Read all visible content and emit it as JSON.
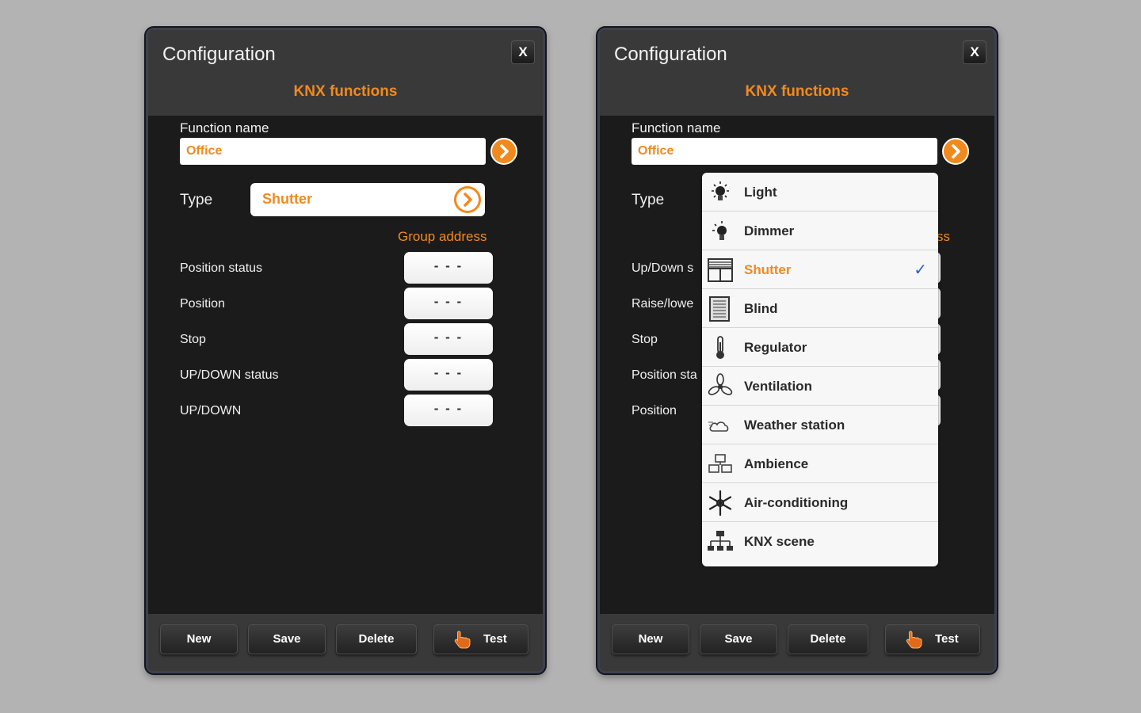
{
  "colors": {
    "accent": "#f18a1e",
    "panel_bg": "#1c1b1b",
    "header_bg": "#3a3939",
    "check": "#2962c9"
  },
  "left": {
    "title": "Configuration",
    "close_label": "X",
    "subtitle": "KNX functions",
    "function_name_label": "Function name",
    "function_name_value": "Office",
    "type_label": "Type",
    "type_value": "Shutter",
    "group_address_label": "Group address",
    "rows": [
      {
        "label": "Position status",
        "value": "- - -"
      },
      {
        "label": "Position",
        "value": "- - -"
      },
      {
        "label": "Stop",
        "value": "- - -"
      },
      {
        "label": "UP/DOWN status",
        "value": "- - -"
      },
      {
        "label": "UP/DOWN",
        "value": "- - -"
      }
    ],
    "footer": {
      "new": "New",
      "save": "Save",
      "delete": "Delete",
      "test": "Test"
    }
  },
  "right": {
    "title": "Configuration",
    "close_label": "X",
    "subtitle": "KNX functions",
    "function_name_label": "Function name",
    "function_name_value": "Office",
    "type_label": "Type",
    "group_address_partial": "ss",
    "rows_partial": [
      "Up/Down s",
      "Raise/lowe",
      "Stop",
      "Position sta",
      "Position"
    ],
    "dropdown": {
      "items": [
        {
          "label": "Light",
          "icon": "lightbulb-icon"
        },
        {
          "label": "Dimmer",
          "icon": "dimmer-bulb-icon"
        },
        {
          "label": "Shutter",
          "icon": "shutter-window-icon",
          "selected": true
        },
        {
          "label": "Blind",
          "icon": "blind-icon"
        },
        {
          "label": "Regulator",
          "icon": "thermometer-icon"
        },
        {
          "label": "Ventilation",
          "icon": "fan-icon"
        },
        {
          "label": "Weather station",
          "icon": "weather-cloud-icon"
        },
        {
          "label": "Ambience",
          "icon": "ambience-blocks-icon"
        },
        {
          "label": "Air-conditioning",
          "icon": "snowflake-icon"
        },
        {
          "label": "KNX scene",
          "icon": "network-scene-icon"
        }
      ],
      "check_mark": "✓"
    },
    "footer": {
      "new": "New",
      "save": "Save",
      "delete": "Delete",
      "test": "Test"
    }
  }
}
